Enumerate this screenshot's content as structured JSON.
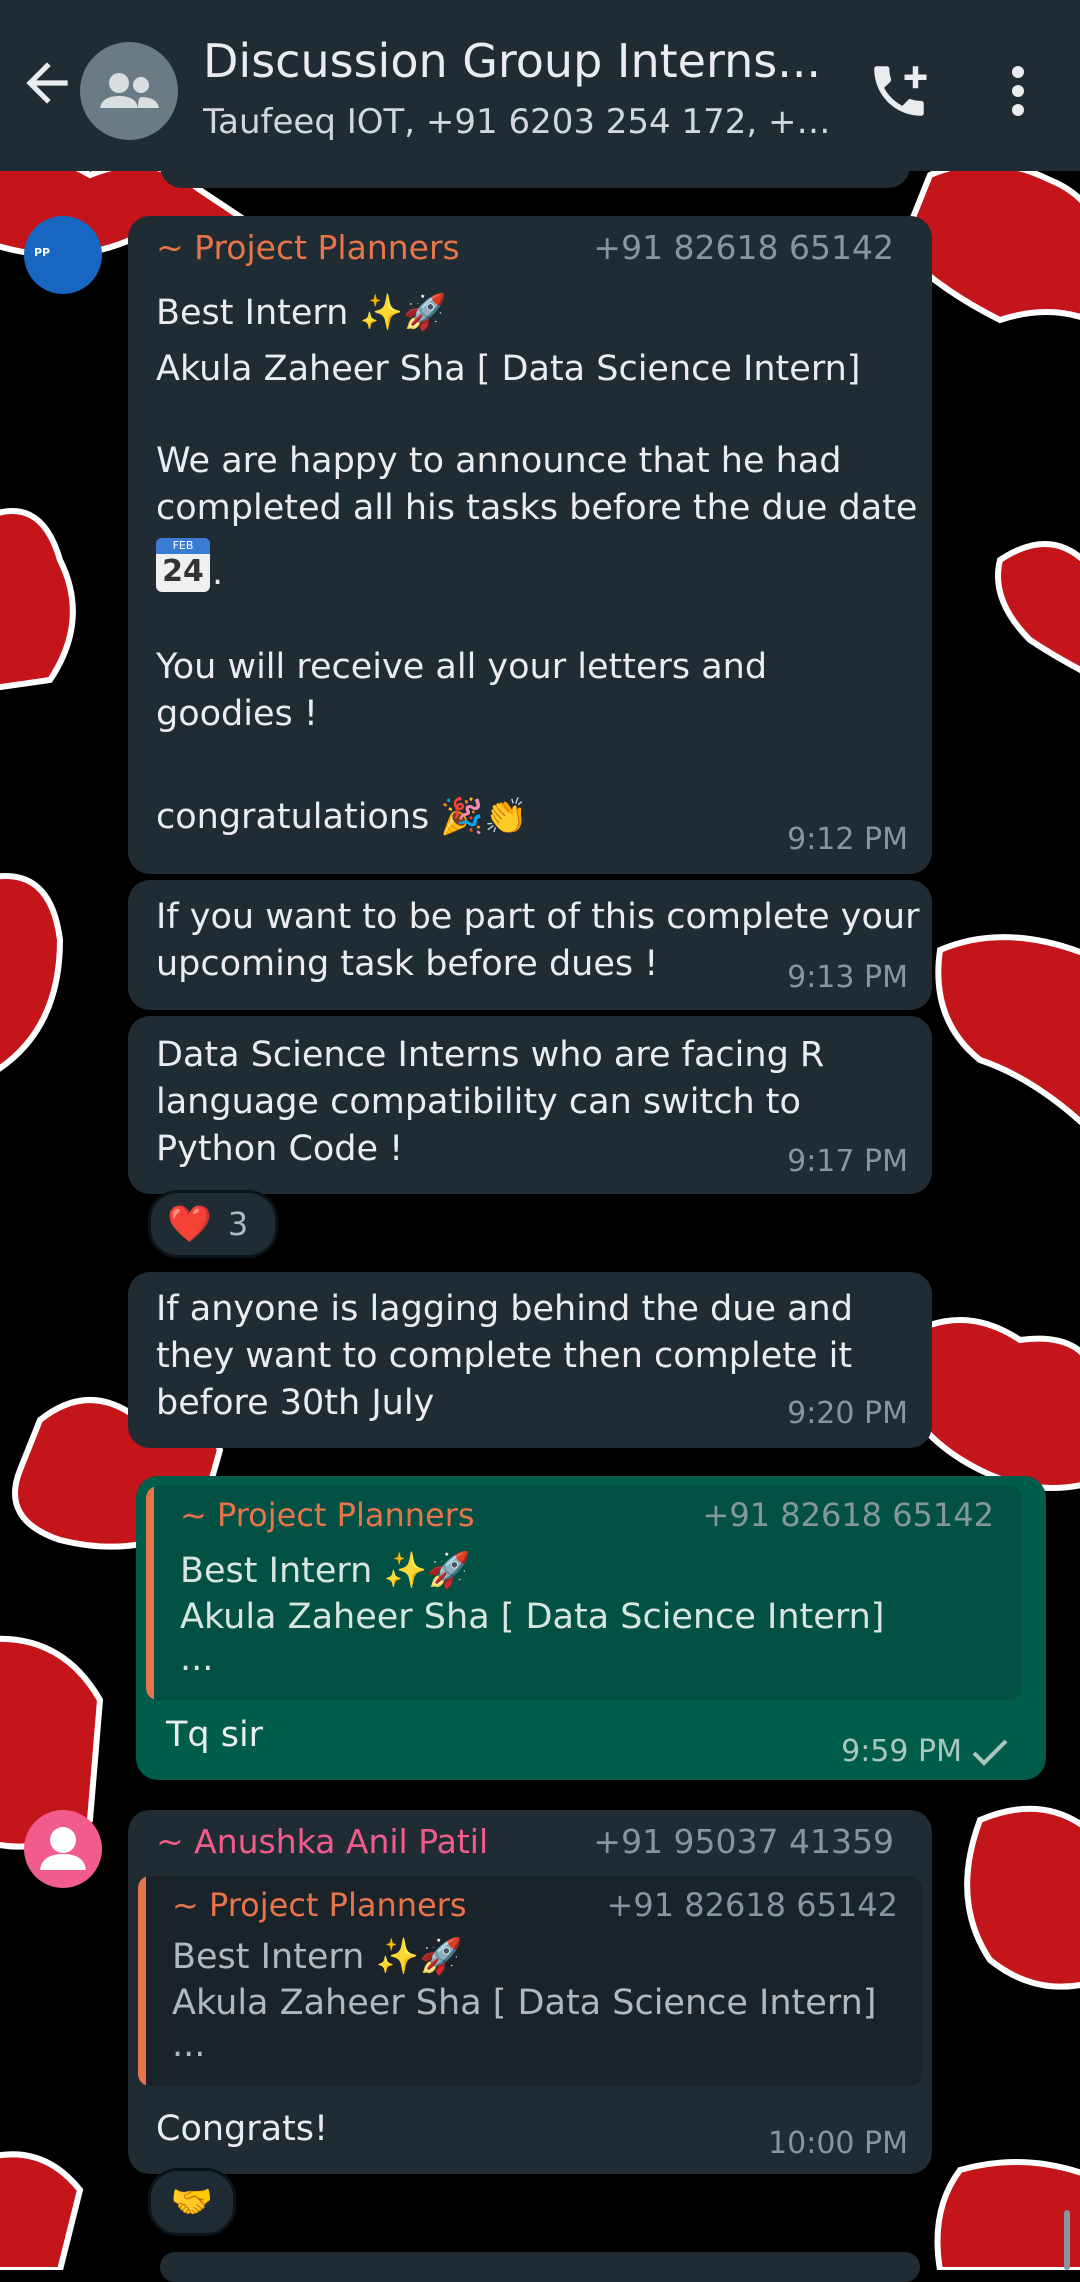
{
  "header": {
    "title": "Discussion Group Interns...",
    "subtitle": "Taufeeq  IOT, +91 6203 254 172, +91..."
  },
  "messages": [
    {
      "sender": "~ Project Planners",
      "phone": "+91 82618 65142",
      "avatar_text": "PP",
      "line1": "Best Intern ✨🚀",
      "line2": "Akula Zaheer Sha [ Data Science Intern]",
      "para1": "We are happy to announce that he had completed all his tasks before the due date",
      "calendar_month": "FEB",
      "calendar_day": "24",
      "para2": "You will receive all your letters and goodies !",
      "para3": "congratulations 🎉👏",
      "time": "9:12 PM"
    },
    {
      "text": "If you want to be part of this complete your upcoming task before dues !",
      "time": "9:13 PM"
    },
    {
      "text": "Data Science Interns who are facing R language compatibility can switch to Python Code !",
      "time": "9:17 PM",
      "reaction_emoji": "❤️",
      "reaction_count": "3"
    },
    {
      "text": "If anyone is lagging behind the due and they want to complete then complete it before 30th July",
      "time": "9:20 PM"
    },
    {
      "quote_sender": "~ Project Planners",
      "quote_phone": "+91 82618 65142",
      "quote_line1": "Best Intern ✨🚀",
      "quote_line2": "Akula Zaheer Sha [ Data Science Intern]",
      "quote_line3": "...",
      "text": "Tq sir",
      "time": "9:59 PM"
    },
    {
      "sender": "~ Anushka Anil Patil",
      "phone": "+91 95037 41359",
      "quote_sender": "~ Project Planners",
      "quote_phone": "+91 82618 65142",
      "quote_line1": "Best Intern ✨🚀",
      "quote_line2": "Akula Zaheer Sha [ Data Science Intern]",
      "quote_line3": "...",
      "text": "Congrats!",
      "time": "10:00 PM",
      "reaction_emoji": "🤝"
    }
  ],
  "colors": {
    "header_bg": "#1f2c34",
    "incoming_bubble": "#202c33",
    "outgoing_bubble": "#005c4b",
    "sender_orange": "#e8744a",
    "sender_pink": "#f15c8c",
    "wallpaper_red": "#c4151b"
  },
  "icons": [
    "back-arrow-icon",
    "group-icon",
    "add-call-icon",
    "more-vert-icon",
    "user-icon",
    "check-icon"
  ]
}
